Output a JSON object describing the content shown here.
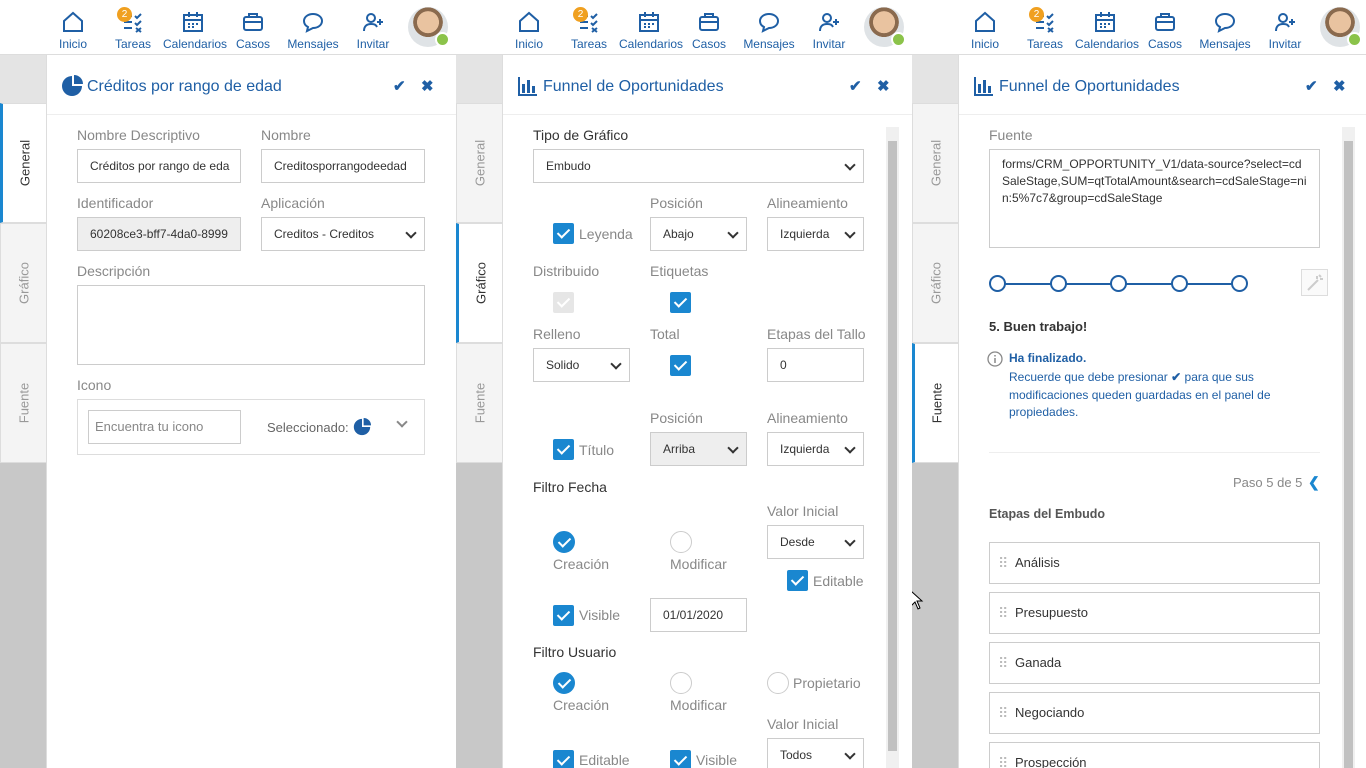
{
  "nav": {
    "items": [
      "Inicio",
      "Tareas",
      "Calendarios",
      "Casos",
      "Mensajes",
      "Invitar"
    ],
    "badge": "2"
  },
  "tabs": {
    "general": "General",
    "grafico": "Gráfico",
    "fuente": "Fuente"
  },
  "p1": {
    "title": "Créditos por rango de edad",
    "nombre_desc_label": "Nombre Descriptivo",
    "nombre_desc_value": "Créditos por rango de eda",
    "nombre_label": "Nombre",
    "nombre_value": "Creditosporrangodeedad",
    "ident_label": "Identificador",
    "ident_value": "60208ce3-bff7-4da0-8999",
    "aplic_label": "Aplicación",
    "aplic_value": "Creditos - Creditos",
    "desc_label": "Descripción",
    "icono_label": "Icono",
    "icono_placeholder": "Encuentra tu icono",
    "seleccionado": "Seleccionado:"
  },
  "p2": {
    "title": "Funnel de Oportunidades",
    "tipo_label": "Tipo de Gráfico",
    "tipo_value": "Embudo",
    "posicion": "Posición",
    "alineamiento": "Alineamiento",
    "leyenda": "Leyenda",
    "leyenda_pos": "Abajo",
    "leyenda_alin": "Izquierda",
    "distribuido": "Distribuido",
    "etiquetas": "Etiquetas",
    "relleno": "Relleno",
    "total": "Total",
    "etapas_tallo": "Etapas del Tallo",
    "relleno_value": "Solido",
    "etapas_value": "0",
    "titulo": "Título",
    "titulo_pos": "Arriba",
    "titulo_alin": "Izquierda",
    "filtro_fecha": "Filtro Fecha",
    "valor_inicial": "Valor Inicial",
    "creacion": "Creación",
    "modificar": "Modificar",
    "desde": "Desde",
    "editable": "Editable",
    "visible": "Visible",
    "fecha_value": "01/01/2020",
    "filtro_usuario": "Filtro Usuario",
    "propietario": "Propietario",
    "todos": "Todos"
  },
  "p3": {
    "title": "Funnel de Oportunidades",
    "fuente_label": "Fuente",
    "fuente_value": "forms/CRM_OPPORTUNITY_V1/data-source?select=cdSaleStage,SUM=qtTotalAmount&search=cdSaleStage=nin:5%7c7&group=cdSaleStage",
    "step_title": "5. Buen trabajo!",
    "finalizado": "Ha finalizado.",
    "recuerde_pre": "Recuerde que debe presionar",
    "recuerde_post": "para que sus",
    "recuerde_line2": "modificaciones queden guardadas en el panel de",
    "recuerde_line3": "propiedades.",
    "paso": "Paso 5 de 5",
    "etapas_title": "Etapas del Embudo",
    "stages": [
      "Análisis",
      "Presupuesto",
      "Ganada",
      "Negociando",
      "Prospección"
    ]
  },
  "colors": {
    "accent": "#1a87d0",
    "brand": "#1f5fa5",
    "badge": "#f0a020",
    "online": "#8bc34a"
  }
}
